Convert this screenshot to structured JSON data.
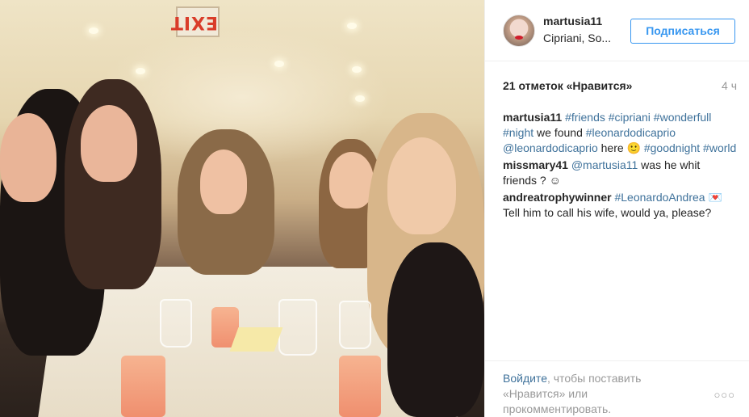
{
  "post": {
    "username": "martusia11",
    "location": "Cipriani, So...",
    "follow_label": "Подписаться",
    "likes": "21 отметок «Нравится»",
    "time_ago": "4 ч",
    "photo_sign": "EXIT"
  },
  "caption": {
    "author": "martusia11",
    "segments": [
      {
        "text": "#friends",
        "tag": true
      },
      {
        "text": " ",
        "tag": false
      },
      {
        "text": "#cipriani",
        "tag": true
      },
      {
        "text": " ",
        "tag": false
      },
      {
        "text": "#wonderfull",
        "tag": true
      },
      {
        "text": " ",
        "tag": false
      },
      {
        "text": "#night",
        "tag": true
      },
      {
        "text": " we found ",
        "tag": false
      },
      {
        "text": "#leonardodicaprio",
        "tag": true
      },
      {
        "text": " ",
        "tag": false
      },
      {
        "text": "@leonardodicaprio",
        "tag": true
      },
      {
        "text": " here 🙂 ",
        "tag": false
      },
      {
        "text": "#goodnight",
        "tag": true
      },
      {
        "text": " ",
        "tag": false
      },
      {
        "text": "#world",
        "tag": true
      }
    ]
  },
  "comments": [
    {
      "author": "missmary41",
      "segments": [
        {
          "text": "@martusia11",
          "tag": true
        },
        {
          "text": " was he whit friends ? ☺",
          "tag": false
        }
      ]
    },
    {
      "author": "andreatrophywinner",
      "segments": [
        {
          "text": "#LeonardoAndrea",
          "tag": true
        },
        {
          "text": " 💌 Tell him to call his wife, would ya, please?",
          "tag": false
        }
      ]
    }
  ],
  "footer": {
    "login_link": "Войдите",
    "login_rest": ", чтобы поставить «Нравится» или прокомментировать.",
    "more": "○○○"
  },
  "colors": {
    "link": "#3f729b",
    "button": "#3897f0",
    "muted": "#999999"
  }
}
